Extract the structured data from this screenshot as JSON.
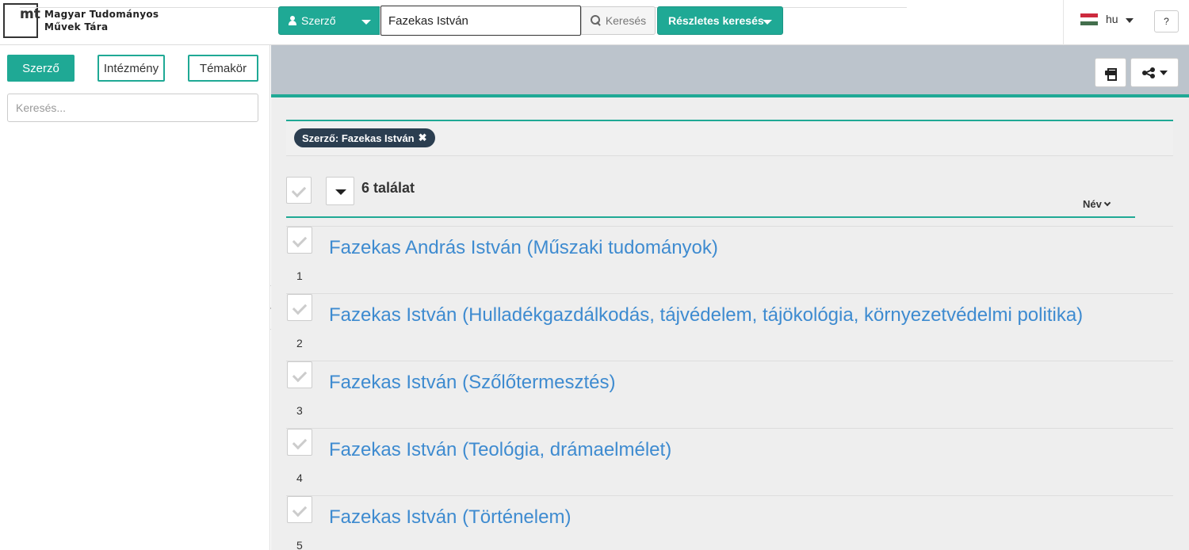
{
  "header": {
    "logo_line1": "mt",
    "logo_line2": "mt",
    "brand_line1": "Magyar Tudományos",
    "brand_line2": "Művek Tára",
    "search_type_label": "Szerző",
    "search_value": "Fazekas István",
    "search_button": "Keresés",
    "advanced_search": "Részletes keresés",
    "language": "hu",
    "help": "?"
  },
  "sidebar": {
    "tabs": [
      {
        "label": "Szerző",
        "active": true
      },
      {
        "label": "Intézmény",
        "active": false
      },
      {
        "label": "Témakör",
        "active": false
      }
    ],
    "search_placeholder": "Keresés..."
  },
  "main": {
    "filter_chip": "Szerző: Fazekas István",
    "filter_chip_close": "✖",
    "result_count": "6 találat",
    "sort_label": "Név",
    "results": [
      {
        "num": "1",
        "title": "Fazekas András István (Műszaki tudományok)"
      },
      {
        "num": "2",
        "title": "Fazekas István (Hulladékgazdálkodás, tájvédelem, tájökológia, környezetvédelmi politika)"
      },
      {
        "num": "3",
        "title": "Fazekas István (Szőlőtermesztés)"
      },
      {
        "num": "4",
        "title": "Fazekas István (Teológia, drámaelmélet)"
      },
      {
        "num": "5",
        "title": "Fazekas István (Történelem)"
      }
    ]
  },
  "colors": {
    "accent": "#1fa995",
    "link": "#3e8bd0",
    "chip_bg": "#2b3e50",
    "topbar": "#bcc4cc"
  }
}
